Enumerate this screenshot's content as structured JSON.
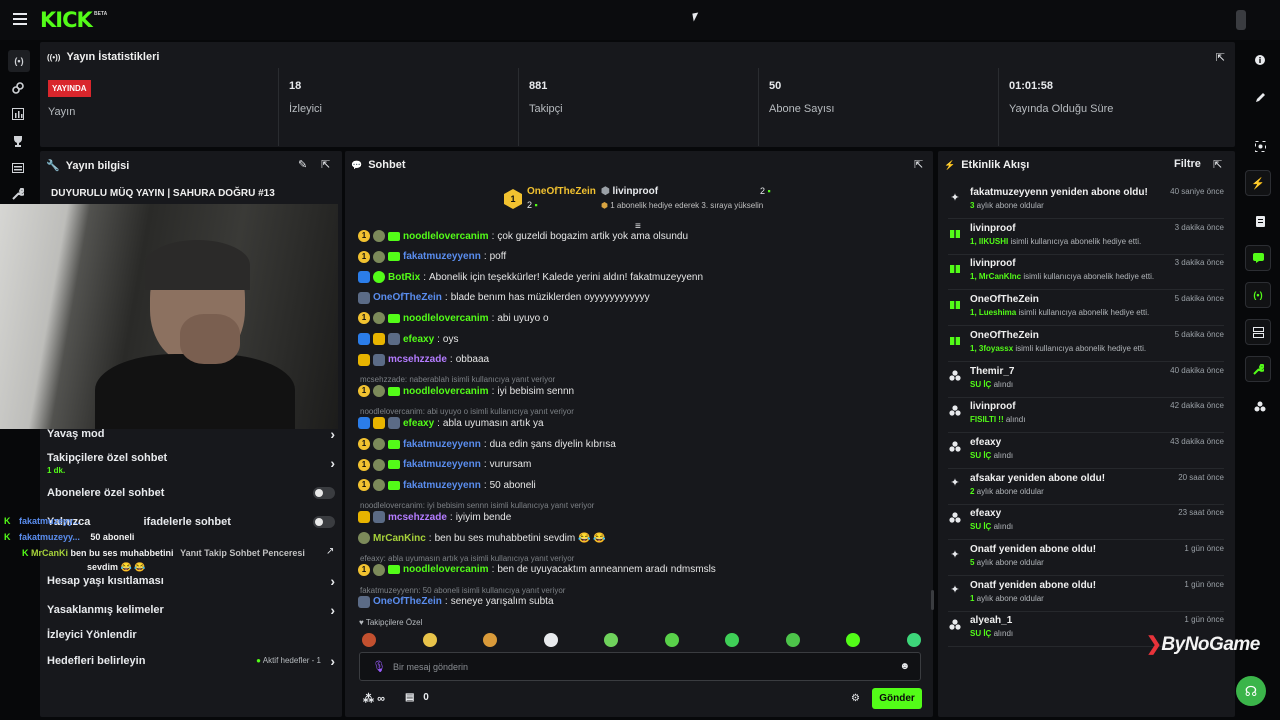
{
  "app": {
    "logo": "KICK",
    "logo_badge": "BETA"
  },
  "stats": {
    "title": "Yayın İstatistikleri",
    "live_badge": "YAYINDA",
    "items": [
      {
        "value": "",
        "label": "Yayın"
      },
      {
        "value": "18",
        "label": "İzleyici"
      },
      {
        "value": "881",
        "label": "Takipçi"
      },
      {
        "value": "50",
        "label": "Abone Sayısı"
      },
      {
        "value": "01:01:58",
        "label": "Yayında Olduğu Süre"
      }
    ]
  },
  "stream_info": {
    "title": "Yayın bilgisi",
    "stream_title": "DUYURULU MÜQ YAYIN | SAHURA DOĞRU #13"
  },
  "settings": {
    "slow_mode": "Yavaş mod",
    "followers_only": "Takipçilere özel sohbet",
    "followers_only_value": "1 dk.",
    "subs_only": "Abonelere özel sohbet",
    "emotes_only": "ifadelerle sohbet",
    "emotes_prefix": "Yalnızca",
    "account_age": "Hesap yaşı kısıtlaması",
    "banned_words": "Yasaklanmış kelimeler",
    "viewer_redirect": "İzleyici Yönlendir",
    "goals": "Hedefleri belirleyin",
    "goals_active": "Aktif hedefler - 1"
  },
  "overlay": {
    "rows": [
      {
        "user": "fakatmuzeyy...",
        "text": "50 aboneli"
      },
      {
        "user": "fakatmuzeyy...",
        "text": "50 aboneli"
      }
    ],
    "extra_user": "MrCanKi",
    "extra_text": "ben bu ses muhabbetini",
    "extra_text2": "sevdim",
    "mod_line": "Yanıt Takip Sohbet Penceresi"
  },
  "chat": {
    "title": "Sohbet",
    "top_gifters": [
      {
        "name": "OneOfTheZein",
        "count": "2",
        "rank": "1"
      },
      {
        "name": "livinproof",
        "count": "2"
      }
    ],
    "gift_note": "1 abonelik hediye ederek 3. sıraya yükselin",
    "messages": [
      {
        "user": "noodlelovercanim",
        "text": "çok guzeldi bogazim artik yok ama olsundu",
        "color": "green",
        "badges": [
          "b1",
          "bmoss",
          "bsub"
        ]
      },
      {
        "user": "fakatmuzeyyenn",
        "text": "poff",
        "color": "blue",
        "badges": [
          "b1",
          "bmoss",
          "bsub"
        ]
      },
      {
        "user": "BotRix",
        "text": "Abonelik için teşekkürler! Kalede yerini aldın! fakatmuzeyyenn",
        "color": "green",
        "badges": [
          "bmod",
          "bver"
        ]
      },
      {
        "user": "OneOfTheZein",
        "text": "blade benım has müziklerden oyyyyyyyyyyyy",
        "color": "blue",
        "badges": [
          "bhex"
        ]
      },
      {
        "user": "noodlelovercanim",
        "text": "abi uyuyo o",
        "color": "green",
        "badges": [
          "b1",
          "bmoss",
          "bsub"
        ]
      },
      {
        "user": "efeaxy",
        "text": "oys",
        "color": "green",
        "badges": [
          "bmod",
          "bvip",
          "bhex"
        ]
      },
      {
        "user": "mcsehzzade",
        "text": "obbaaa",
        "color": "purple",
        "badges": [
          "bvip",
          "bhex"
        ]
      },
      {
        "reply": "mcsehzzade: naberablah isimli kullanıcıya yanıt veriyor",
        "user": "noodlelovercanim",
        "text": "iyi bebisim sennn",
        "color": "green",
        "badges": [
          "b1",
          "bmoss",
          "bsub"
        ]
      },
      {
        "reply": "noodlelovercanim: abi uyuyo o isimli kullanıcıya yanıt veriyor",
        "user": "efeaxy",
        "text": "abla uyumasın artık ya",
        "color": "green",
        "badges": [
          "bmod",
          "bvip",
          "bhex"
        ]
      },
      {
        "user": "fakatmuzeyyenn",
        "text": "dua edin şans diyelin kıbrısa",
        "color": "blue",
        "badges": [
          "b1",
          "bmoss",
          "bsub"
        ]
      },
      {
        "user": "fakatmuzeyyenn",
        "text": "vurursam",
        "color": "blue",
        "badges": [
          "b1",
          "bmoss",
          "bsub"
        ]
      },
      {
        "user": "fakatmuzeyyenn",
        "text": "50 aboneli",
        "color": "blue",
        "badges": [
          "b1",
          "bmoss",
          "bsub"
        ]
      },
      {
        "reply": "noodlelovercanim: iyi bebisim sennn isimli kullanıcıya yanıt veriyor",
        "user": "mcsehzzade",
        "text": "iyiyim bende",
        "color": "purple",
        "badges": [
          "bvip",
          "bhex"
        ]
      },
      {
        "user": "MrCanKinc",
        "text": "ben bu ses muhabbetini sevdim 😂 😂",
        "color": "olive",
        "badges": [
          "bmoss"
        ]
      },
      {
        "reply": "efeaxy: abla uyumasın artık ya   isimli kullanıcıya yanıt veriyor",
        "user": "noodlelovercanim",
        "text": "ben de uyuyacaktım anneannem aradı ndmsmsls",
        "color": "green",
        "badges": [
          "b1",
          "bmoss",
          "bsub"
        ]
      },
      {
        "reply": "fakatmuzeyyenn: 50 aboneli isimli kullanıcıya yanıt veriyor",
        "user": "OneOfTheZein",
        "text": "seneye yarışalım subta",
        "color": "blue",
        "badges": [
          "bhex"
        ]
      }
    ],
    "followers_label": "Takipçilere Özel",
    "input_placeholder": "Bir mesaj gönderin",
    "points": "∞",
    "shop_count": "0",
    "send": "Gönder"
  },
  "activity": {
    "title": "Etkinlik Akışı",
    "filter": "Filtre",
    "items": [
      {
        "icon": "sparkle",
        "title": "fakatmuzeyyenn yeniden abone oldu!",
        "sub_hl": "3",
        "sub": " aylık abone oldular",
        "time": "40 saniye önce"
      },
      {
        "icon": "gift",
        "title": "livinproof",
        "sub_hl": "1, IIKUSHI",
        "sub": " isimli kullanıcıya abonelik hediye etti.",
        "time": "3 dakika önce"
      },
      {
        "icon": "gift",
        "title": "livinproof",
        "sub_hl": "1, MrCanKInc",
        "sub": " isimli kullanıcıya abonelik hediye etti.",
        "time": "3 dakika önce"
      },
      {
        "icon": "gift",
        "title": "OneOfTheZein",
        "sub_hl": "1, Lueshima",
        "sub": " isimli kullanıcıya abonelik hediye etti.",
        "time": "5 dakika önce"
      },
      {
        "icon": "gift",
        "title": "OneOfTheZein",
        "sub_hl": "1, 3foyassx",
        "sub": " isimli kullanıcıya abonelik hediye etti.",
        "time": "5 dakika önce"
      },
      {
        "icon": "dots",
        "title": "Themir_7",
        "sub_hl": "SU İÇ",
        "sub": " alındı",
        "time": "40 dakika önce"
      },
      {
        "icon": "dots",
        "title": "livinproof",
        "sub_hl": "FISILTI !!",
        "sub": " alındı",
        "time": "42 dakika önce"
      },
      {
        "icon": "dots",
        "title": "efeaxy",
        "sub_hl": "SU İÇ",
        "sub": " alındı",
        "time": "43 dakika önce"
      },
      {
        "icon": "sparkle",
        "title": "afsakar yeniden abone oldu!",
        "sub_hl": "2",
        "sub": " aylık abone oldular",
        "time": "20 saat önce"
      },
      {
        "icon": "dots",
        "title": "efeaxy",
        "sub_hl": "SU İÇ",
        "sub": " alındı",
        "time": "23 saat önce"
      },
      {
        "icon": "sparkle",
        "title": "Onatf yeniden abone oldu!",
        "sub_hl": "5",
        "sub": " aylık abone oldular",
        "time": "1 gün önce"
      },
      {
        "icon": "sparkle",
        "title": "Onatf yeniden abone oldu!",
        "sub_hl": "1",
        "sub": " aylık abone oldular",
        "time": "1 gün önce"
      },
      {
        "icon": "dots",
        "title": "alyeah_1",
        "sub_hl": "SU İÇ",
        "sub": " alındı",
        "time": "1 gün önce"
      }
    ]
  },
  "watermark": "ByNoGame",
  "colors": {
    "accent": "#53fc18",
    "live": "#d9262c",
    "bg": "#07080a",
    "panel": "#17181c"
  }
}
